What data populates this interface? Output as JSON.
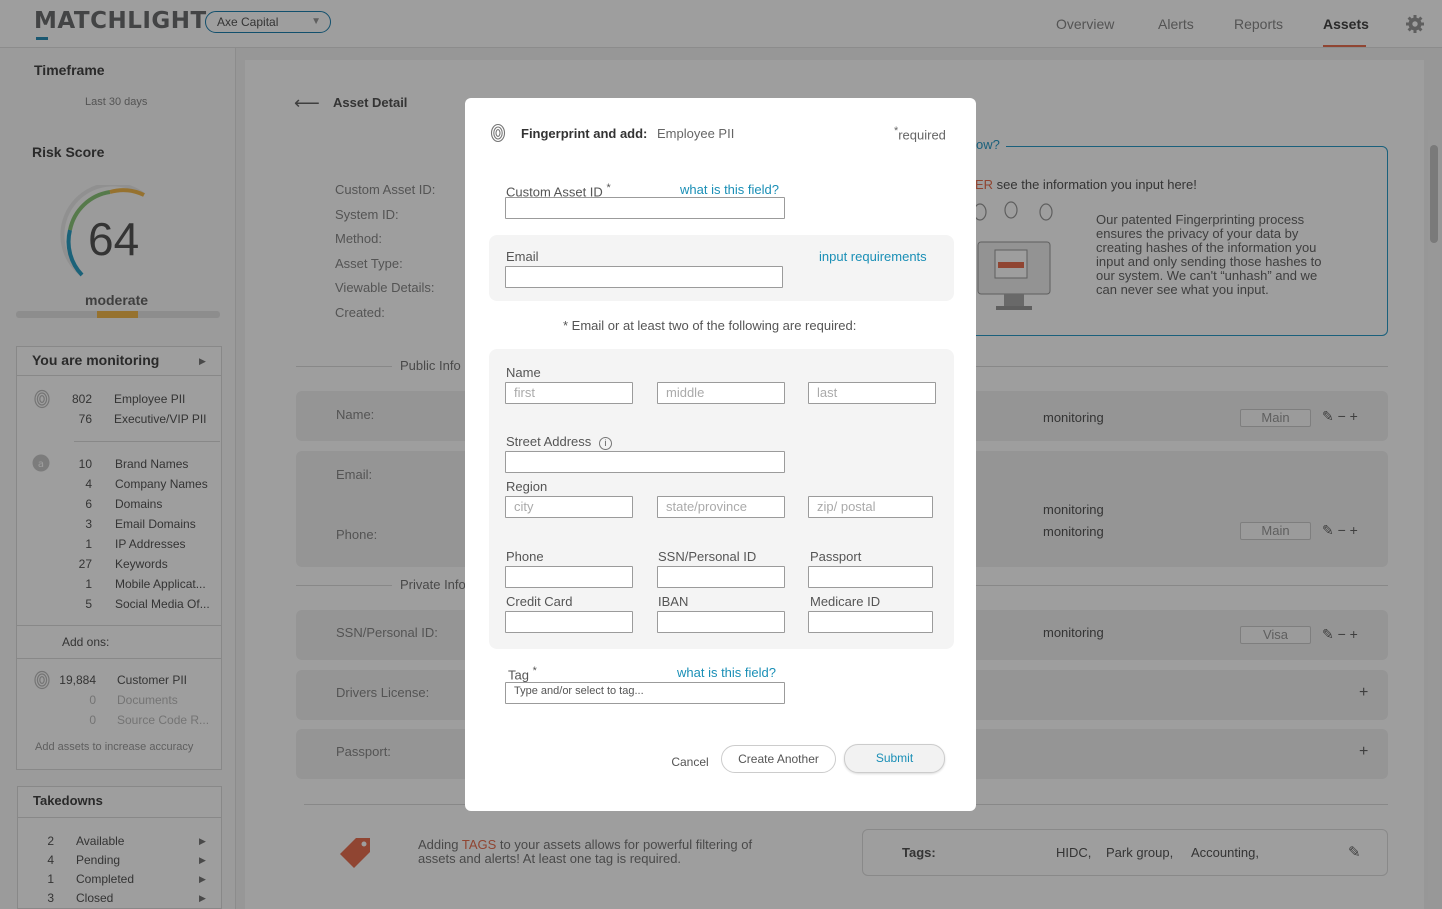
{
  "header": {
    "logo": "MATCHLIGHT",
    "org_select": "Axe Capital",
    "nav": [
      "Overview",
      "Alerts",
      "Reports",
      "Assets"
    ],
    "active_nav": "Assets"
  },
  "sidebar": {
    "timeframe_title": "Timeframe",
    "timeframe_value": "Last 30 days",
    "risk_title": "Risk Score",
    "risk_score": "64",
    "risk_label": "moderate",
    "monitoring_title": "You are monitoring",
    "fingerprint_assets": [
      {
        "count": "802",
        "label": "Employee PII"
      },
      {
        "count": "76",
        "label": "Executive/VIP PII"
      }
    ],
    "keyword_assets": [
      {
        "count": "10",
        "label": "Brand Names"
      },
      {
        "count": "4",
        "label": "Company Names"
      },
      {
        "count": "6",
        "label": "Domains"
      },
      {
        "count": "3",
        "label": "Email Domains"
      },
      {
        "count": "1",
        "label": "IP Addresses"
      },
      {
        "count": "27",
        "label": "Keywords"
      },
      {
        "count": "1",
        "label": "Mobile Applicat..."
      },
      {
        "count": "5",
        "label": "Social Media Of..."
      }
    ],
    "addons_title": "Add ons:",
    "addon_assets": [
      {
        "count": "19,884",
        "label": "Customer PII"
      },
      {
        "count": "0",
        "label": "Documents"
      },
      {
        "count": "0",
        "label": "Source Code R..."
      }
    ],
    "add_assets_hint": "Add assets to increase accuracy",
    "takedowns_title": "Takedowns",
    "takedowns": [
      {
        "count": "2",
        "label": "Available"
      },
      {
        "count": "4",
        "label": "Pending"
      },
      {
        "count": "1",
        "label": "Completed"
      },
      {
        "count": "3",
        "label": "Closed"
      }
    ]
  },
  "main": {
    "back_title": "Asset Detail",
    "details_labels": [
      "Custom Asset ID:",
      "System ID:",
      "Method:",
      "Asset Type:",
      "Viewable Details:",
      "Created:"
    ],
    "how_link": "ow?",
    "info_highlight": "ER",
    "info_line": " see the information you input here!",
    "info_text": "Our patented Fingerprinting process ensures the privacy of your data by creating hashes of the information you input and only sending those hashes to our system. We can't “unhash” and we can never see what you input.",
    "public_section": "Public Info",
    "private_section": "Private Info",
    "rows": [
      {
        "label": "Name:",
        "status": "monitoring",
        "tag": "Main"
      },
      {
        "label": "Email:",
        "status": "",
        "tag": ""
      },
      {
        "label": "Phone:",
        "status": "monitoring",
        "status2": "monitoring",
        "tag": "Main"
      },
      {
        "label": "SSN/Personal ID:",
        "status": "monitoring",
        "tag": "Visa"
      },
      {
        "label": "Drivers License:",
        "status": "",
        "tag": ""
      },
      {
        "label": "Passport:",
        "status": "",
        "tag": ""
      }
    ],
    "tags_hint_prefix": "Adding ",
    "tags_hint_highlight": "TAGS",
    "tags_hint_rest": " to your assets allows for powerful filtering of assets and alerts! At least one tag is required.",
    "tags_label": "Tags:",
    "tags": [
      "HIDC,",
      "Park group,",
      "Accounting,"
    ]
  },
  "modal": {
    "title": "Fingerprint and add:",
    "subtitle": "Employee PII",
    "required_star": "*",
    "required": "required",
    "custom_id_label": "Custom Asset ID",
    "what_is": "what is this field?",
    "email_label": "Email",
    "input_requirements": "input requirements",
    "requirement_note": "* Email or at least two of the following are required:",
    "name_label": "Name",
    "name_placeholders": [
      "first",
      "middle",
      "last"
    ],
    "street_label": "Street Address",
    "region_label": "Region",
    "region_placeholders": [
      "city",
      "state/province",
      "zip/ postal"
    ],
    "phone_label": "Phone",
    "ssn_label": "SSN/Personal ID",
    "passport_label": "Passport",
    "credit_label": "Credit Card",
    "iban_label": "IBAN",
    "medicare_label": "Medicare ID",
    "tag_label": "Tag",
    "tag_placeholder": "Type and/or select to tag...",
    "cancel": "Cancel",
    "create_another": "Create Another",
    "submit": "Submit"
  },
  "colors": {
    "accent": "#1a8fb6",
    "orange": "#e87051",
    "gauge_yellow": "#f2b84c"
  }
}
